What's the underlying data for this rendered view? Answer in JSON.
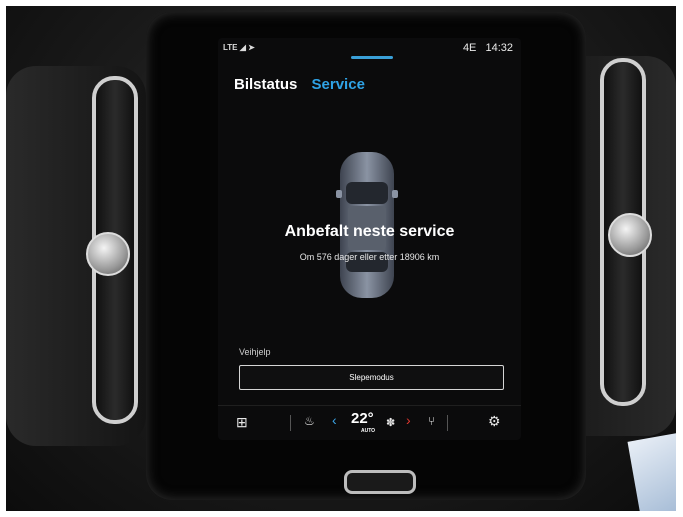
{
  "status_bar": {
    "signal_text": "LTE",
    "network": "4E",
    "time": "14:32"
  },
  "tabs": [
    {
      "label": "Bilstatus",
      "active": false
    },
    {
      "label": "Service",
      "active": true
    }
  ],
  "service": {
    "headline": "Anbefalt neste service",
    "detail": "Om 576 dager eller etter 18906 km"
  },
  "roadside": {
    "section_label": "Veihjelp",
    "tow_button_label": "Slepemodus"
  },
  "climate": {
    "temperature": "22°",
    "mode": "AUTO",
    "icons": [
      "apps-grid-icon",
      "seat-heat-icon",
      "chevron-left-icon",
      "fan-icon",
      "chevron-right-icon",
      "seat-icon",
      "settings-gear-icon"
    ]
  },
  "colors": {
    "accent_blue": "#2fa3e6",
    "temp_down": "#3ca7ea",
    "temp_up": "#e0372f"
  }
}
